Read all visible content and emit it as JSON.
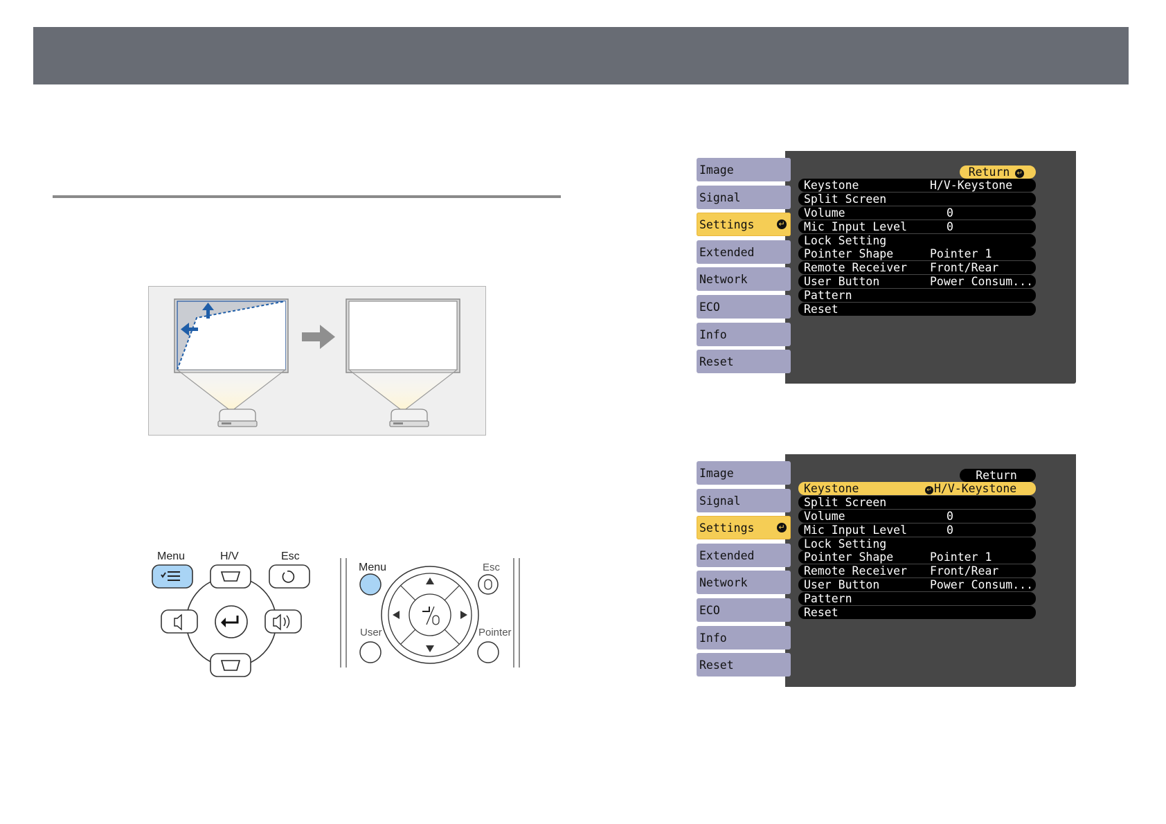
{
  "control_panel": {
    "menu_label": "Menu",
    "hv_label": "H/V",
    "esc_label": "Esc"
  },
  "remote": {
    "menu_label": "Menu",
    "esc_label": "Esc",
    "user_label": "User",
    "pointer_label": "Pointer"
  },
  "colors": {
    "menu_button_highlight": "#a9d4f5",
    "header_bar": "#686c74",
    "osd_highlight": "#f5cd55",
    "osd_side_item": "#a3a3c2"
  },
  "osd_before": {
    "return_label": "Return",
    "sidebar": [
      {
        "label": "Image"
      },
      {
        "label": "Signal"
      },
      {
        "label": "Settings",
        "active": true
      },
      {
        "label": "Extended"
      },
      {
        "label": "Network"
      },
      {
        "label": "ECO"
      },
      {
        "label": "Info"
      },
      {
        "label": "Reset"
      }
    ],
    "rows": [
      {
        "label": "Keystone",
        "value": "H/V-Keystone"
      },
      {
        "label": "Split Screen",
        "value": ""
      },
      {
        "label": "Volume",
        "value": "0"
      },
      {
        "label": "Mic Input Level",
        "value": "0"
      },
      {
        "label": "Lock Setting",
        "value": ""
      },
      {
        "label": "Pointer Shape",
        "value": "Pointer 1"
      },
      {
        "label": "Remote Receiver",
        "value": "Front/Rear"
      },
      {
        "label": "User Button",
        "value": "Power Consum..."
      },
      {
        "label": "Pattern",
        "value": ""
      },
      {
        "label": "Reset",
        "value": ""
      }
    ]
  },
  "osd_after": {
    "return_label": "Return",
    "sidebar": [
      {
        "label": "Image"
      },
      {
        "label": "Signal"
      },
      {
        "label": "Settings",
        "active": true
      },
      {
        "label": "Extended"
      },
      {
        "label": "Network"
      },
      {
        "label": "ECO"
      },
      {
        "label": "Info"
      },
      {
        "label": "Reset"
      }
    ],
    "rows": [
      {
        "label": "Keystone",
        "value": "H/V-Keystone",
        "highlight": true
      },
      {
        "label": "Split Screen",
        "value": ""
      },
      {
        "label": "Volume",
        "value": "0"
      },
      {
        "label": "Mic Input Level",
        "value": "0"
      },
      {
        "label": "Lock Setting",
        "value": ""
      },
      {
        "label": "Pointer Shape",
        "value": "Pointer 1"
      },
      {
        "label": "Remote Receiver",
        "value": "Front/Rear"
      },
      {
        "label": "User Button",
        "value": "Power Consum..."
      },
      {
        "label": "Pattern",
        "value": ""
      },
      {
        "label": "Reset",
        "value": ""
      }
    ]
  }
}
